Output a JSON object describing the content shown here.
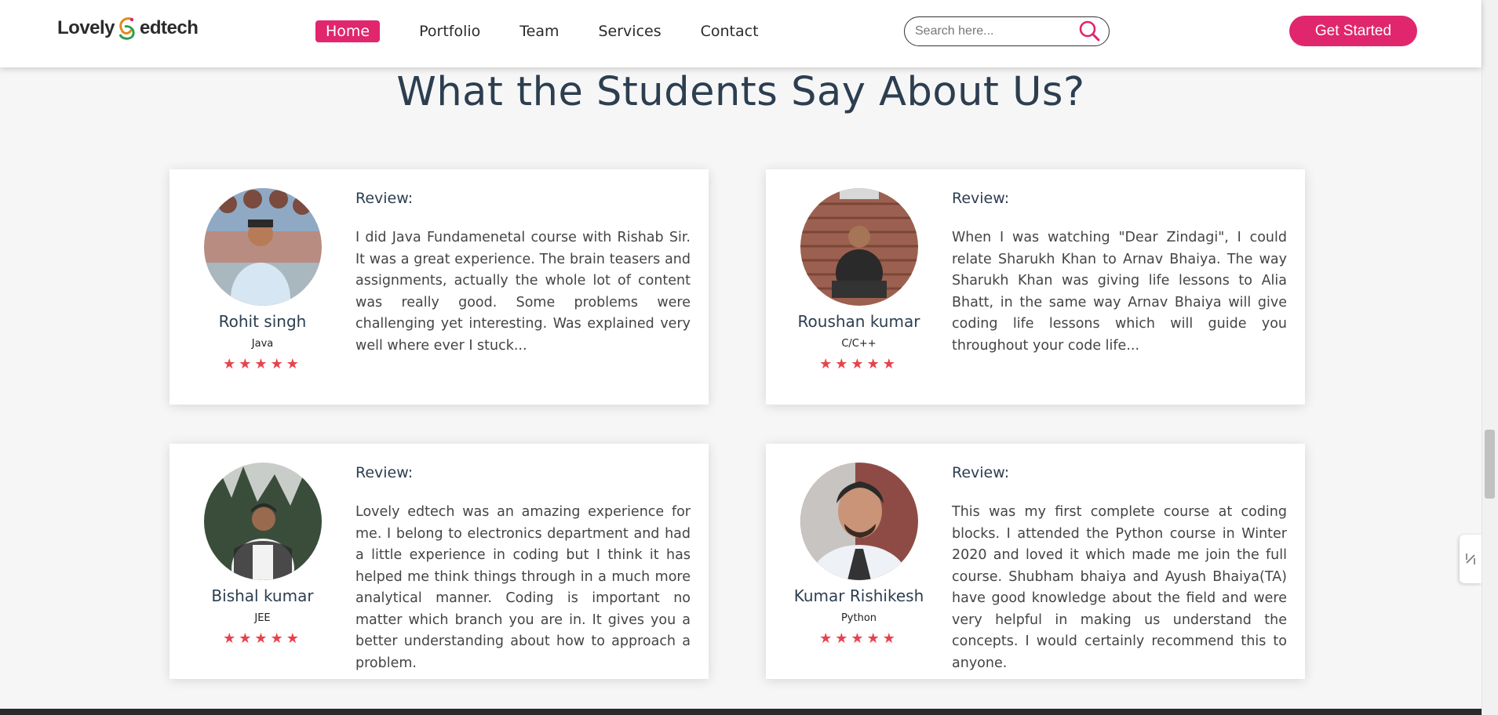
{
  "header": {
    "logo": {
      "left": "Lovely",
      "right": "edtech"
    },
    "nav": [
      {
        "label": "Home",
        "active": true
      },
      {
        "label": "Portfolio",
        "active": false
      },
      {
        "label": "Team",
        "active": false
      },
      {
        "label": "Services",
        "active": false
      },
      {
        "label": "Contact",
        "active": false
      }
    ],
    "search": {
      "placeholder": "Search here...",
      "icon": "search-icon"
    },
    "cta_label": "Get Started"
  },
  "section": {
    "title": "What the Students Say About Us?"
  },
  "testimonials": [
    {
      "name": "Rohit singh",
      "course": "Java",
      "stars": "★★★★★",
      "rating": 5,
      "review_heading": "Review:",
      "review": "I did Java Fundamenetal course with Rishab Sir. It was a great experience. The brain teasers and assignments, actually the whole lot of content was really good. Some problems were challenging yet interesting. Was explained very well where ever I stuck..."
    },
    {
      "name": "Roushan kumar",
      "course": "C/C++",
      "stars": "★★★★★",
      "rating": 5,
      "review_heading": "Review:",
      "review": "When I was watching \"Dear Zindagi\", I could relate Sharukh Khan to Arnav Bhaiya. The way Sharukh Khan was giving life lessons to Alia Bhatt, in the same way Arnav Bhaiya will give coding life lessons which will guide you throughout your code life..."
    },
    {
      "name": "Bishal kumar",
      "course": "JEE",
      "stars": "★★★★★",
      "rating": 5,
      "review_heading": "Review:",
      "review": "Lovely edtech was an amazing experience for me. I belong to electronics department and had a little experience in coding but I think it has helped me think things through in a much more analytical manner. Coding is important no matter which branch you are in. It gives you a better understanding about how to approach a problem."
    },
    {
      "name": "Kumar Rishikesh",
      "course": "Python",
      "stars": "★★★★★",
      "rating": 5,
      "review_heading": "Review:",
      "review": "This was my first complete course at coding blocks. I attended the Python course in Winter 2020 and loved it which made me join the full course. Shubham bhaiya and Ayush Bhaiya(TA) have good knowledge about the field and were very helpful in making us understand the concepts. I would certainly recommend this to anyone."
    }
  ],
  "colors": {
    "accent": "#e0266d",
    "star": "#e8424d",
    "heading": "#2c3e50"
  }
}
